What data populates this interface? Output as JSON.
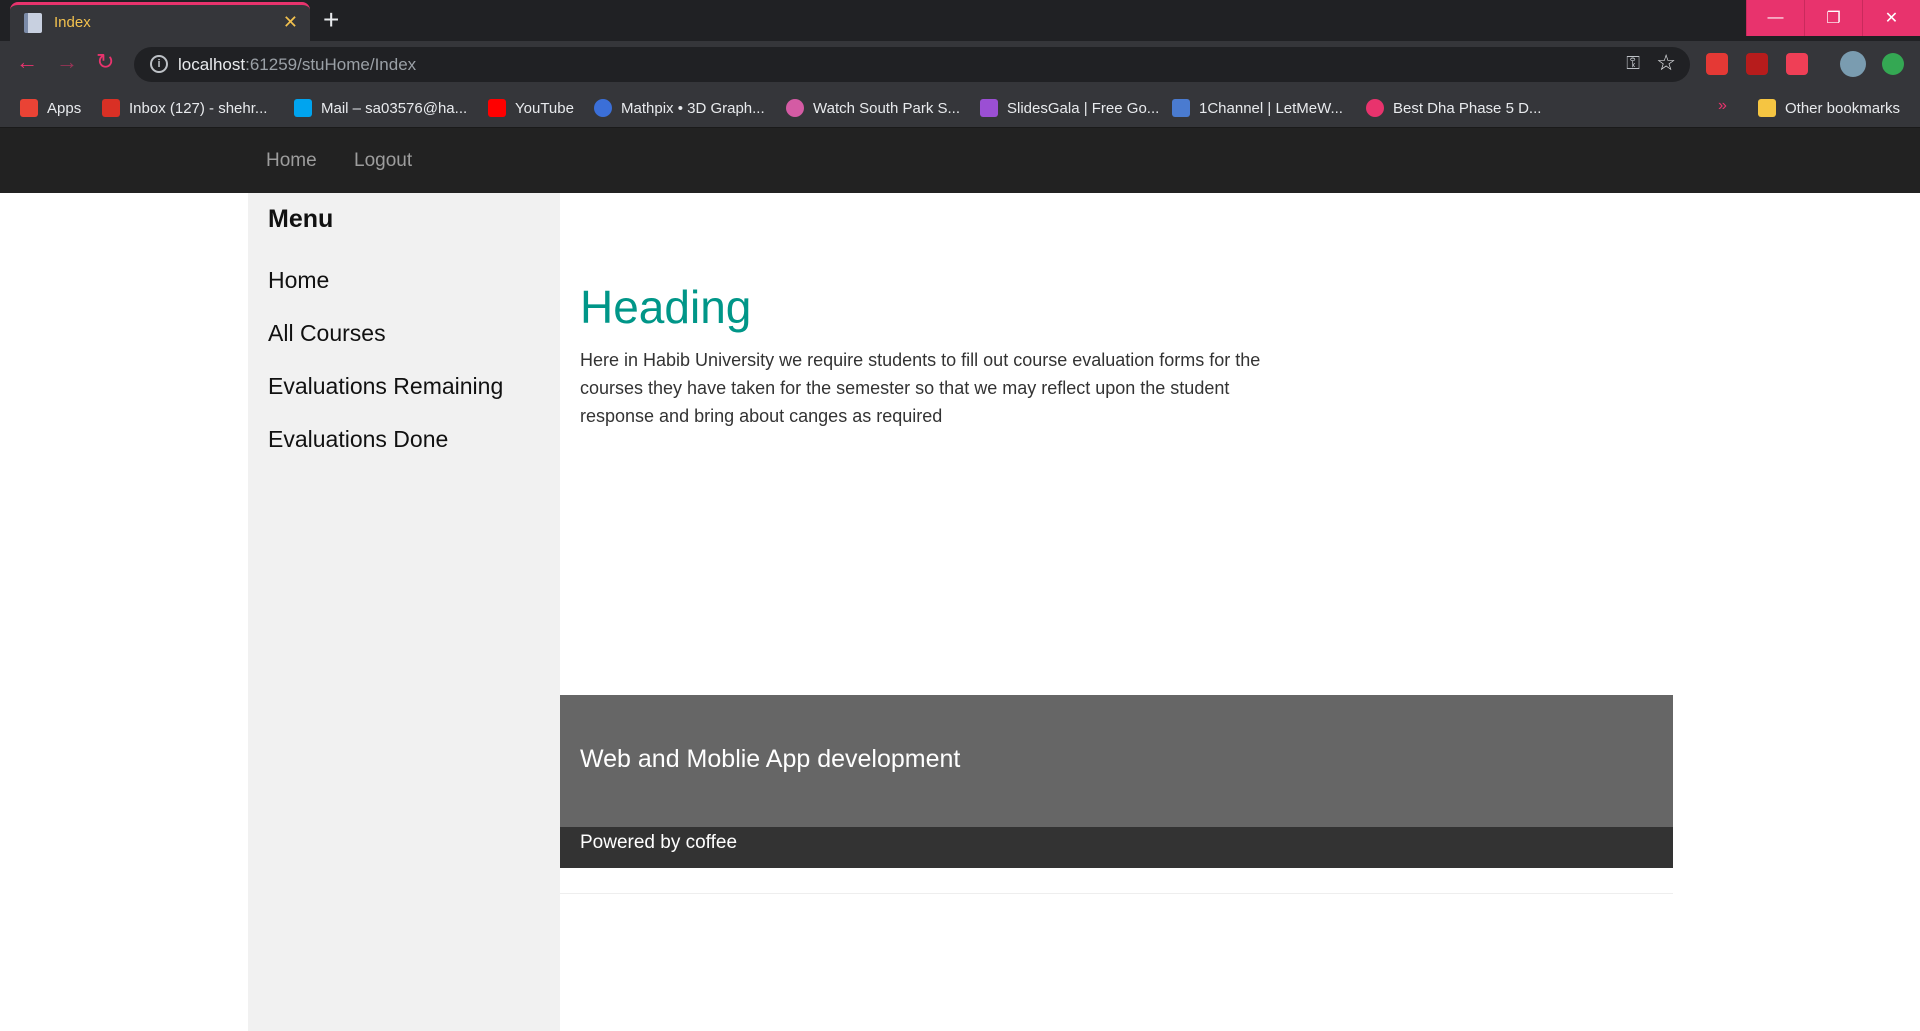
{
  "browser": {
    "tab_title": "Index",
    "close_glyph": "✕",
    "new_tab_glyph": "+",
    "window_controls": [
      "—",
      "❐",
      "✕"
    ],
    "url_host": "localhost",
    "url_path": ":61259/stuHome/Index",
    "back_glyph": "←",
    "forward_glyph": "→",
    "reload_glyph": "↻",
    "info_glyph": "i",
    "key_glyph": "⚿",
    "star_glyph": "☆",
    "extensions": [
      {
        "name": "red-shield-extension-icon",
        "color": "#e53935"
      },
      {
        "name": "pdf-extension-icon",
        "color": "#b71c1c"
      },
      {
        "name": "pocket-extension-icon",
        "color": "#ef3f56"
      },
      {
        "name": "profile-avatar-icon",
        "color": "#7a9cb0"
      },
      {
        "name": "update-arrow-icon",
        "color": "#34a853"
      }
    ],
    "bookmarks": [
      {
        "label": "Apps",
        "color": "#ea4335"
      },
      {
        "label": "Inbox (127) - shehr...",
        "color": "#d93025"
      },
      {
        "label": "Mail – sa03576@ha...",
        "color": "#00a4ef"
      },
      {
        "label": "YouTube",
        "color": "#ff0000"
      },
      {
        "label": "Mathpix • 3D Graph...",
        "color": "#3b6fd8"
      },
      {
        "label": "Watch South Park S...",
        "color": "#d45ba4"
      },
      {
        "label": "SlidesGala | Free Go...",
        "color": "#9b4fd4"
      },
      {
        "label": "1Channel | LetMeW...",
        "color": "#4a7bd0"
      },
      {
        "label": "Best Dha Phase 5 D...",
        "color": "#e8336d"
      }
    ],
    "bookmarks_more": "»",
    "other_bookmarks": "Other bookmarks",
    "other_bookmarks_color": "#f5c542"
  },
  "navbar": {
    "links": [
      "Home",
      "Logout"
    ]
  },
  "sidebar": {
    "title": "Menu",
    "items": [
      "Home",
      "All Courses",
      "Evaluations Remaining",
      "Evaluations Done"
    ]
  },
  "main": {
    "heading": "Heading",
    "intro": "Here in Habib University we require students to fill out course evaluation forms for the courses they have taken for the semester so that we may reflect upon the student response and bring about canges as required"
  },
  "footer": {
    "title": "Web and Moblie App development",
    "powered": "Powered by coffee"
  },
  "colors": {
    "accent": "#e8336d",
    "heading": "#009688",
    "navbar_bg": "#222222",
    "sidebar_bg": "#f1f1f1",
    "footer_top_bg": "#666666",
    "footer_bottom_bg": "#333333"
  }
}
